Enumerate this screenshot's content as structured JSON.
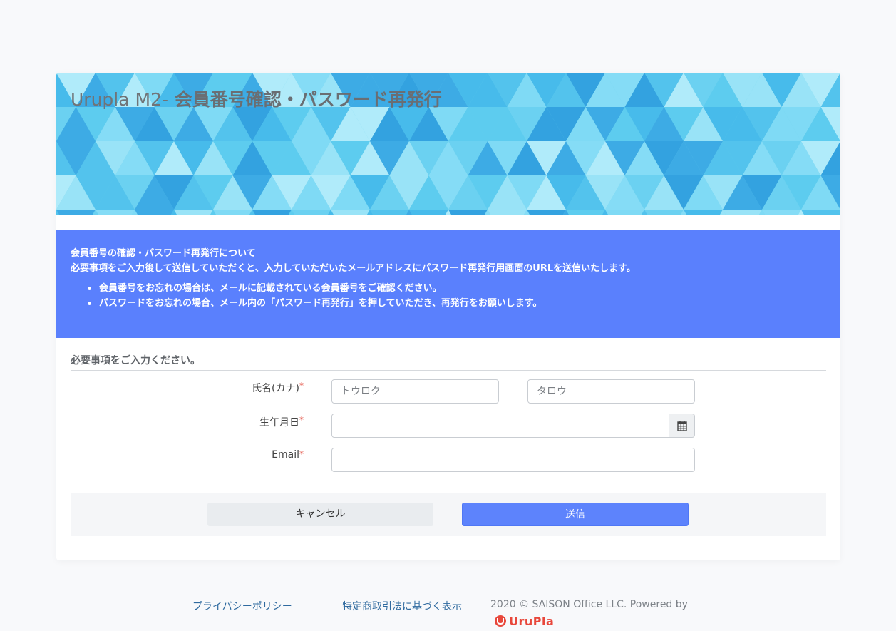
{
  "banner": {
    "title_prefix": "Urupla M2-",
    "title_main": " 会員番号確認・パスワード再発行"
  },
  "info": {
    "heading": "会員番号の確認・パスワード再発行について",
    "description": "必要事項をご入力後して送信していただくと、入力していただいたメールアドレスにパスワード再発行用画面のURLを送信いたします。",
    "bullets": [
      "会員番号をお忘れの場合は、メールに記載されている会員番号をご確認ください。",
      "パスワードをお忘れの場合、メール内の「パスワード再発行」を押していただき、再発行をお願いします。"
    ]
  },
  "form": {
    "section_title": "必要事項をご入力ください。",
    "required_mark": "*",
    "name_label": "氏名(カナ)",
    "last_name_placeholder": "トウロク",
    "first_name_placeholder": "タロウ",
    "birthday_label": "生年月日",
    "birthday_value": "",
    "email_label": "Email",
    "email_value": "",
    "calendar_icon": "calendar-icon"
  },
  "actions": {
    "cancel_label": "キャンセル",
    "submit_label": "送信"
  },
  "footer": {
    "privacy_link": "プライバシーポリシー",
    "commerce_link": "特定商取引法に基づく表示",
    "copyright": "2020 © SAISON Office LLC.    Powered by",
    "logo_text": "UruPla"
  },
  "colors": {
    "background": "#f8f9fb",
    "info_bg": "#5a80fd",
    "submit_bg": "#5d83fc",
    "required": "#e4574b",
    "link": "#2f6a9f",
    "logo": "#e8473b"
  }
}
